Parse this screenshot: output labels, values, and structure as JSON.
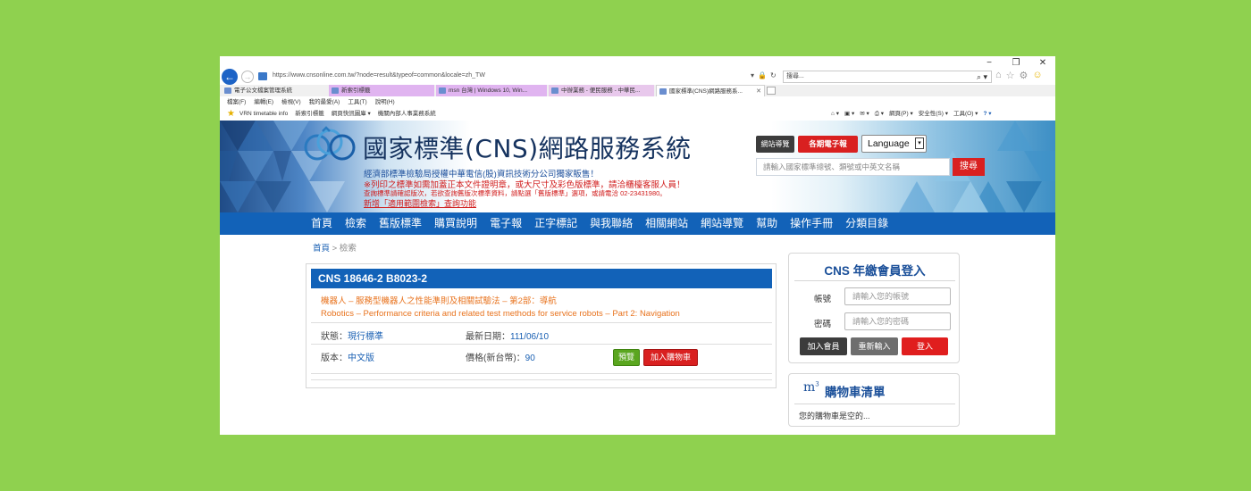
{
  "browser": {
    "window_controls": [
      "−",
      "❐",
      "✕"
    ],
    "url": "https://www.cnsonline.com.tw/?node=result&typeof=common&locale=zh_TW",
    "search_text": "搜尋...",
    "tabs": [
      {
        "label": "電子公文檔案管理系統"
      },
      {
        "label": "新索引標籤"
      },
      {
        "label": "msn 台灣 | Windows 10, Win..."
      },
      {
        "label": "中辦業務 - 便民服務 - 中華民..."
      },
      {
        "label": "國家標準(CNS)網路服務系..."
      }
    ],
    "menu": [
      "檔案(F)",
      "編輯(E)",
      "檢視(V)",
      "我的最愛(A)",
      "工具(T)",
      "說明(H)"
    ],
    "favorites": [
      "VRN timetable info",
      "新索引標籤",
      "網頁快訊圖庫 ▾",
      "機關內部人事業務系統"
    ],
    "command_bar": [
      "網頁(P) ▾",
      "安全性(S) ▾",
      "工具(O) ▾"
    ]
  },
  "site": {
    "title": "國家標準(CNS)網路服務系統",
    "announcements": [
      "經濟部標準檢驗局授權中華電信(股)資訊技術分公司獨家販售！",
      "※列印之標準如需加蓋正本文件證明章，或大尺寸及彩色版標準，請洽櫃檯客服人員！",
      "查詢標準請確認版次，若欲查詢舊版次標準資料，請點選「舊版標準」選項，或請電洽 02-23431980。",
      "新增「適用範圍檢索」查詢功能"
    ],
    "site_nav_button": "網站導覽",
    "e_news_button": "各期電子報",
    "language_label": "Language",
    "search_placeholder": "請輸入國家標準總號、類號或中英文名稱",
    "search_button": "搜尋"
  },
  "nav": [
    "首頁",
    "檢索",
    "舊版標準",
    "購買說明",
    "電子報",
    "正字標記",
    "與我聯絡",
    "相關網站",
    "網站導覽",
    "幫助",
    "操作手冊",
    "分類目錄"
  ],
  "breadcrumb": {
    "home": "首頁",
    "sep": ">",
    "current": "檢索"
  },
  "result": {
    "code": "CNS 18646-2   B8023-2",
    "title_zh": "機器人 – 服務型機器人之性能準則及相關試驗法 – 第2部：導航",
    "title_en": "Robotics – Performance criteria and related test methods for service robots – Part 2: Navigation",
    "status_label": "狀態：",
    "status_value": "現行標準",
    "date_label": "最新日期：",
    "date_value": "111/06/10",
    "version_label": "版本：",
    "version_value": "中文版",
    "price_label": "價格(新台幣)：",
    "price_value": "90",
    "preview_button": "預覽",
    "cart_button": "加入購物車"
  },
  "login": {
    "title": "CNS 年繳會員登入",
    "account_label": "帳號",
    "account_placeholder": "請輸入您的帳號",
    "password_label": "密碼",
    "password_placeholder": "請輸入您的密碼",
    "join_button": "加入會員",
    "reset_button": "重新輸入",
    "login_button": "登入"
  },
  "cart": {
    "title": "購物車清單",
    "empty_text": "您的購物車是空的..."
  },
  "colors": {
    "background": "#8fd14f",
    "nav_blue": "#1262b8",
    "accent_red": "#d92020",
    "orange_text": "#e8731e"
  }
}
